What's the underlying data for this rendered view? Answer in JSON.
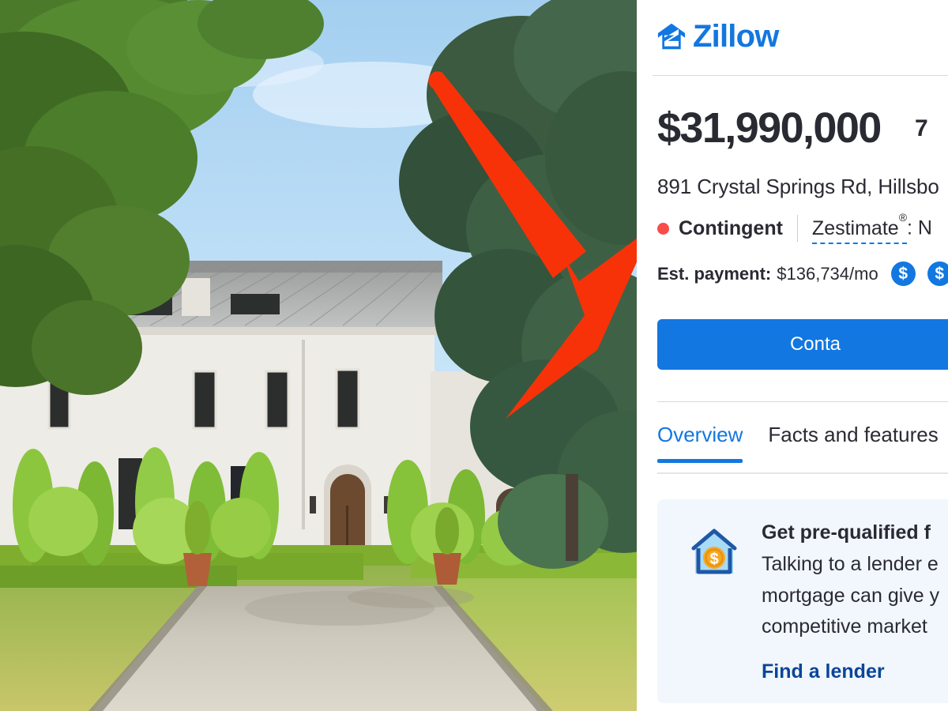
{
  "brand": {
    "name": "Zillow",
    "logo_icon": "zillow-house-icon",
    "color": "#1277e1"
  },
  "listing": {
    "price": "$31,990,000",
    "price_extra_cut": "7",
    "address": "891 Crystal Springs Rd, Hillsbo",
    "status": "Contingent",
    "status_color": "#fa4b4b",
    "zestimate_label": "Zestimate",
    "zestimate_reg": "®",
    "zestimate_value": ": N",
    "payment_label": "Est. payment:",
    "payment_value": "$136,734/mo",
    "payment_icon": "dollar-coin-icon",
    "payment_icon_2": "dollar-coin-icon",
    "coin_glyph": "$"
  },
  "actions": {
    "contact_button": "Conta",
    "contact_button_full": "Contact agent"
  },
  "tabs": [
    {
      "label": "Overview",
      "active": true
    },
    {
      "label": "Facts and features",
      "active": false
    }
  ],
  "promo": {
    "icon": "house-money-icon",
    "title": "Get pre-qualified f",
    "lines": [
      "Talking to a lender e",
      "mortgage can give y",
      "competitive market"
    ],
    "link": "Find a lender",
    "bg": "#f1f7fd",
    "link_color": "#0b4599"
  },
  "annotation": {
    "arrow_color": "#f73208",
    "arrow_points_to": "Contingent"
  },
  "photo": {
    "alt": "Large white Italianate mansion with gray tile roof, manicured topiary hedges, gravel driveway and mature trees"
  }
}
